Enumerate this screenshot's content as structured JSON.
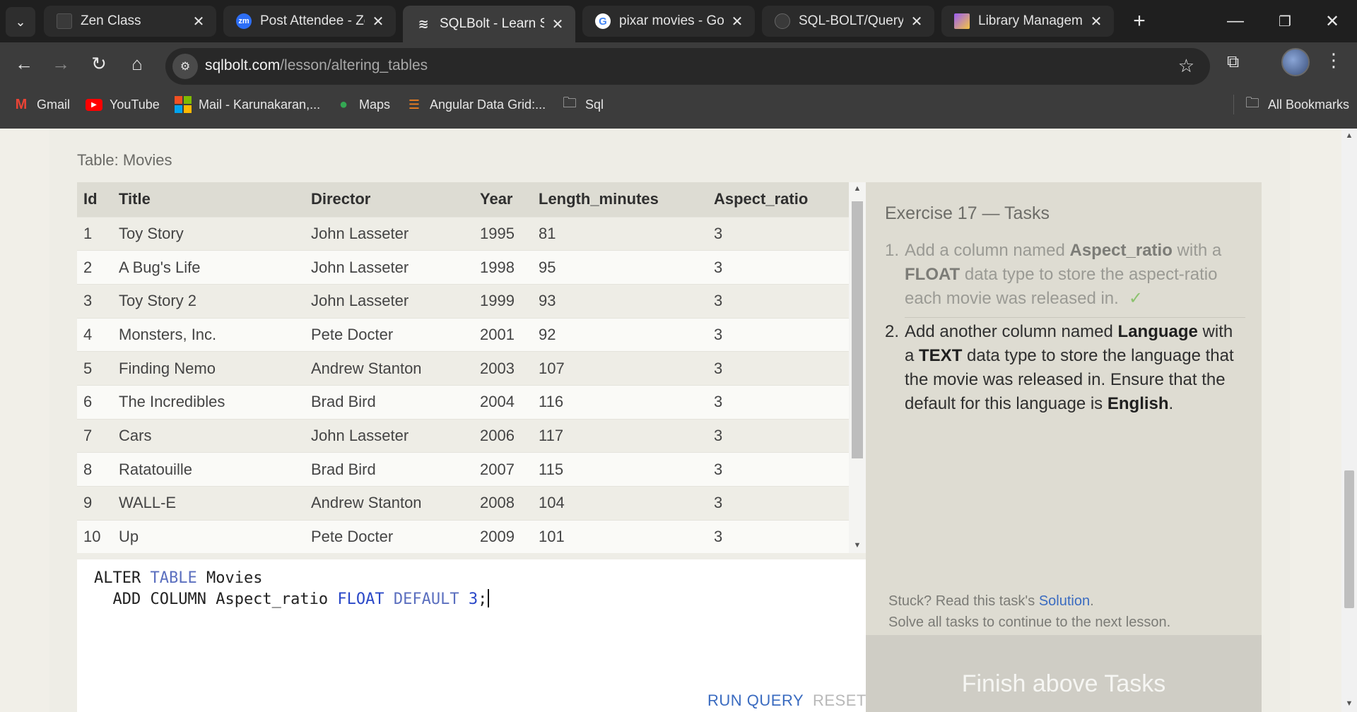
{
  "tabs": [
    {
      "title": "Zen Class",
      "icon": "zen-class-favicon",
      "active": false
    },
    {
      "title": "Post Attendee - Zoom",
      "icon": "zoom-favicon",
      "active": false
    },
    {
      "title": "SQLBolt - Learn SQL",
      "icon": "sqlbolt-favicon",
      "active": true
    },
    {
      "title": "pixar movies - Google",
      "icon": "google-favicon",
      "active": false
    },
    {
      "title": "SQL-BOLT/Query-A",
      "icon": "github-favicon",
      "active": false
    },
    {
      "title": "Library Management",
      "icon": "vite-favicon",
      "active": false
    }
  ],
  "address_bar": {
    "domain": "sqlbolt.com",
    "path": "/lesson/altering_tables"
  },
  "bookmarks": [
    {
      "label": "Gmail",
      "icon": "gmail-icon"
    },
    {
      "label": "YouTube",
      "icon": "youtube-icon"
    },
    {
      "label": "Mail - Karunakaran,...",
      "icon": "microsoft-icon"
    },
    {
      "label": "Maps",
      "icon": "maps-icon"
    },
    {
      "label": "Angular Data Grid:...",
      "icon": "ag-grid-icon"
    },
    {
      "label": "Sql",
      "icon": "folder-icon"
    }
  ],
  "all_bookmarks_label": "All Bookmarks",
  "table_caption": "Table: Movies",
  "results": {
    "columns": [
      "Id",
      "Title",
      "Director",
      "Year",
      "Length_minutes",
      "Aspect_ratio"
    ],
    "rows": [
      [
        "1",
        "Toy Story",
        "John Lasseter",
        "1995",
        "81",
        "3"
      ],
      [
        "2",
        "A Bug's Life",
        "John Lasseter",
        "1998",
        "95",
        "3"
      ],
      [
        "3",
        "Toy Story 2",
        "John Lasseter",
        "1999",
        "93",
        "3"
      ],
      [
        "4",
        "Monsters, Inc.",
        "Pete Docter",
        "2001",
        "92",
        "3"
      ],
      [
        "5",
        "Finding Nemo",
        "Andrew Stanton",
        "2003",
        "107",
        "3"
      ],
      [
        "6",
        "The Incredibles",
        "Brad Bird",
        "2004",
        "116",
        "3"
      ],
      [
        "7",
        "Cars",
        "John Lasseter",
        "2006",
        "117",
        "3"
      ],
      [
        "8",
        "Ratatouille",
        "Brad Bird",
        "2007",
        "115",
        "3"
      ],
      [
        "9",
        "WALL-E",
        "Andrew Stanton",
        "2008",
        "104",
        "3"
      ],
      [
        "10",
        "Up",
        "Pete Docter",
        "2009",
        "101",
        "3"
      ]
    ]
  },
  "query": {
    "line1_kw1": "ALTER",
    "line1_kw2": "TABLE",
    "line1_name": "Movies",
    "line2_kw1": "ADD COLUMN",
    "line2_col": "Aspect_ratio",
    "line2_type": "FLOAT",
    "line2_default": "DEFAULT",
    "line2_value": "3",
    "line2_end": ";"
  },
  "run_query_label": "RUN QUERY",
  "reset_label": "RESET",
  "exercise": {
    "title": "Exercise 17 — Tasks",
    "tasks": [
      {
        "number": "1.",
        "text_before": "Add a column named ",
        "bold1": "Aspect_ratio",
        "text_mid": " with a ",
        "bold2": "FLOAT",
        "text_after": " data type to store the aspect-ratio each movie was released in.",
        "check": "✓",
        "done": true
      },
      {
        "number": "2.",
        "text_before": "Add another column named ",
        "bold1": "Language",
        "text_mid": " with a ",
        "bold2": "TEXT",
        "text_after": " data type to store the language that the movie was released in. Ensure that the default for this language is ",
        "bold3": "English",
        "text_end": ".",
        "done": false
      }
    ],
    "stuck_prefix": "Stuck? Read this task's ",
    "solution_link": "Solution",
    "stuck_suffix": ".",
    "continue_text": "Solve all tasks to continue to the next lesson.",
    "finish_label": "Finish above Tasks"
  }
}
